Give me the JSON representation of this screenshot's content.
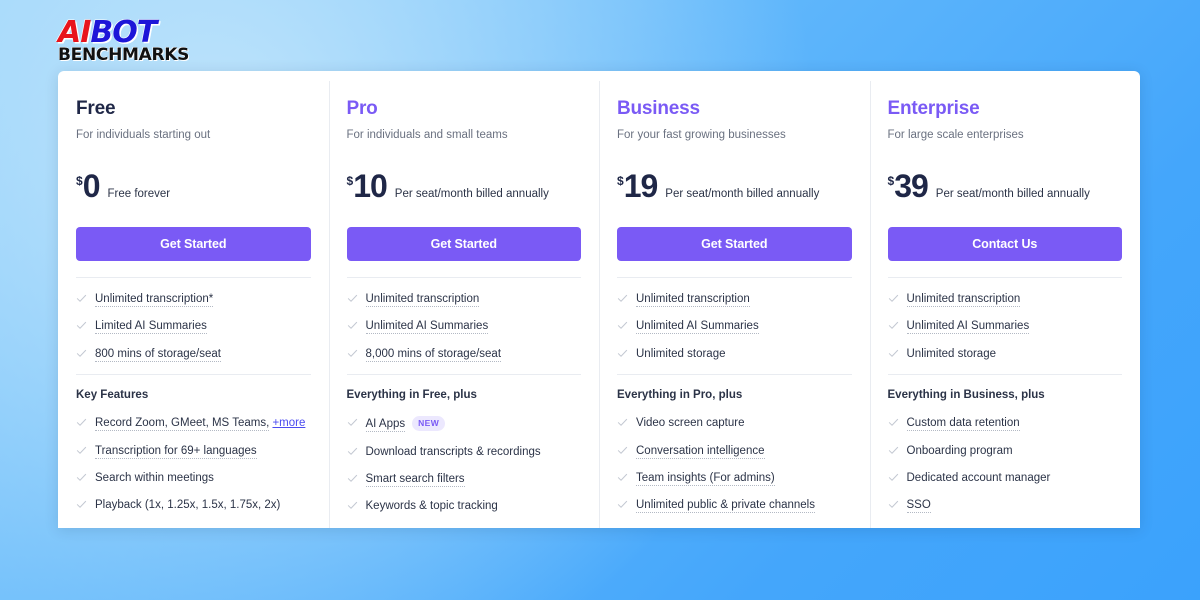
{
  "logo": {
    "part1": "AI",
    "part2": "BOT",
    "part3": "BENCHMARKS"
  },
  "colors": {
    "accent_purple": "#7a5af5",
    "title_dark": "#1f2747",
    "link_blue": "#4b4bf0",
    "badge_bg": "#ece8fe",
    "background_blue": "#44a6fb"
  },
  "plans": [
    {
      "name": "Free",
      "name_color": "dark",
      "tagline": "For individuals starting out",
      "currency": "$",
      "amount": "0",
      "price_note": "Free forever",
      "cta_label": "Get Started",
      "core_features": [
        {
          "label": "Unlimited transcription*",
          "dotted": true
        },
        {
          "label": "Limited AI Summaries",
          "dotted": true
        },
        {
          "label": "800 mins of storage/seat",
          "dotted": true
        }
      ],
      "section_title": "Key Features",
      "extra_features": [
        {
          "label": "Record Zoom, GMeet, MS Teams,",
          "dotted": true,
          "link": "+more"
        },
        {
          "label": "Transcription for 69+ languages",
          "dotted": true
        },
        {
          "label": "Search within meetings",
          "dotted": false
        },
        {
          "label": "Playback (1x, 1.25x, 1.5x, 1.75x, 2x)",
          "dotted": false
        }
      ]
    },
    {
      "name": "Pro",
      "name_color": "purple",
      "tagline": "For individuals and small teams",
      "currency": "$",
      "amount": "10",
      "price_note": "Per seat/month billed annually",
      "cta_label": "Get Started",
      "core_features": [
        {
          "label": "Unlimited transcription",
          "dotted": true
        },
        {
          "label": "Unlimited AI Summaries",
          "dotted": true
        },
        {
          "label": "8,000 mins of storage/seat",
          "dotted": true
        }
      ],
      "section_title": "Everything in Free, plus",
      "extra_features": [
        {
          "label": "AI Apps",
          "dotted": true,
          "badge": "NEW"
        },
        {
          "label": "Download transcripts & recordings",
          "dotted": false
        },
        {
          "label": "Smart search filters",
          "dotted": true
        },
        {
          "label": "Keywords & topic tracking",
          "dotted": false
        }
      ]
    },
    {
      "name": "Business",
      "name_color": "purple",
      "tagline": "For your fast growing businesses",
      "currency": "$",
      "amount": "19",
      "price_note": "Per seat/month billed annually",
      "cta_label": "Get Started",
      "core_features": [
        {
          "label": "Unlimited transcription",
          "dotted": true
        },
        {
          "label": "Unlimited AI Summaries",
          "dotted": true
        },
        {
          "label": "Unlimited storage",
          "dotted": false
        }
      ],
      "section_title": "Everything in Pro, plus",
      "extra_features": [
        {
          "label": "Video screen capture",
          "dotted": false
        },
        {
          "label": "Conversation intelligence",
          "dotted": true
        },
        {
          "label": "Team insights (For admins)",
          "dotted": true
        },
        {
          "label": "Unlimited public & private channels",
          "dotted": true
        }
      ]
    },
    {
      "name": "Enterprise",
      "name_color": "purple",
      "tagline": "For large scale enterprises",
      "currency": "$",
      "amount": "39",
      "price_note": "Per seat/month billed annually",
      "cta_label": "Contact Us",
      "core_features": [
        {
          "label": "Unlimited transcription",
          "dotted": true
        },
        {
          "label": "Unlimited AI Summaries",
          "dotted": true
        },
        {
          "label": "Unlimited storage",
          "dotted": false
        }
      ],
      "section_title": "Everything in Business, plus",
      "extra_features": [
        {
          "label": "Custom data retention",
          "dotted": true
        },
        {
          "label": "Onboarding program",
          "dotted": false
        },
        {
          "label": "Dedicated account manager",
          "dotted": false
        },
        {
          "label": "SSO",
          "dotted": true
        }
      ]
    }
  ]
}
